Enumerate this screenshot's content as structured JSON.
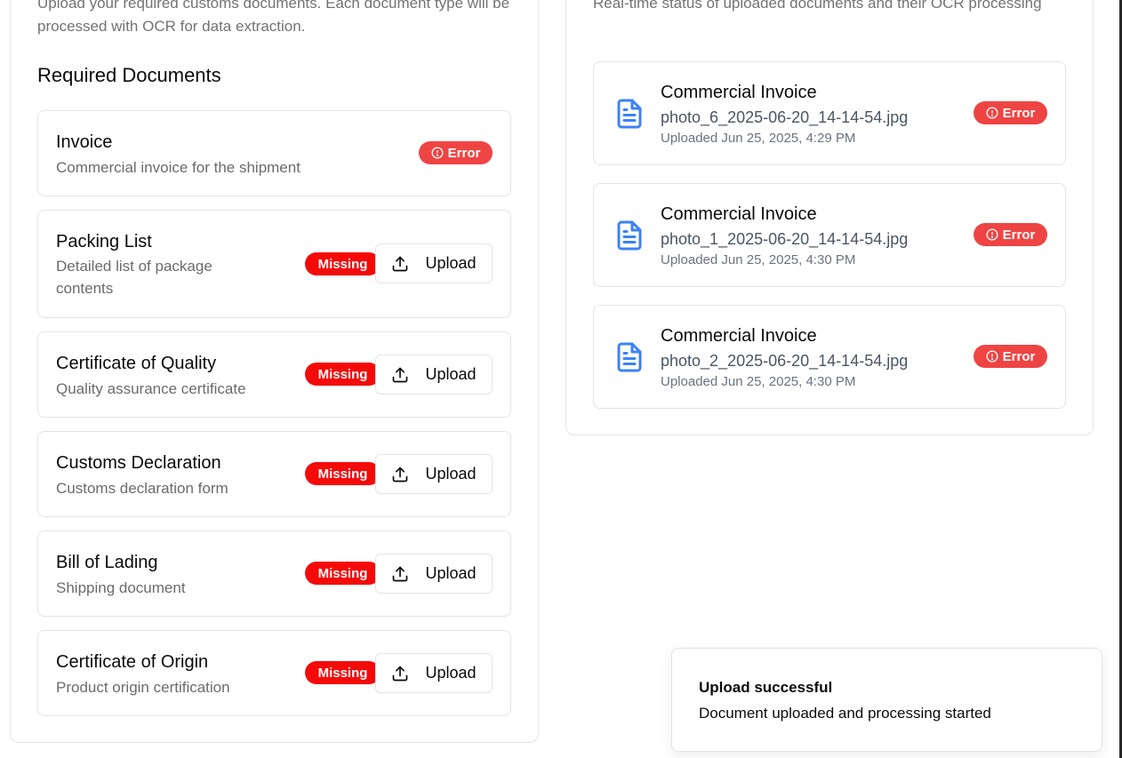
{
  "left_panel": {
    "description": "Upload your required customs documents. Each document type will be processed with OCR for data extraction.",
    "section_title": "Required Documents",
    "upload_label": "Upload",
    "documents": [
      {
        "title": "Invoice",
        "subtitle": "Commercial invoice for the shipment",
        "status": "Error"
      },
      {
        "title": "Packing List",
        "subtitle": "Detailed list of package contents",
        "status": "Missing"
      },
      {
        "title": "Certificate of Quality",
        "subtitle": "Quality assurance certificate",
        "status": "Missing"
      },
      {
        "title": "Customs Declaration",
        "subtitle": "Customs declaration form",
        "status": "Missing"
      },
      {
        "title": "Bill of Lading",
        "subtitle": "Shipping document",
        "status": "Missing"
      },
      {
        "title": "Certificate of Origin",
        "subtitle": "Product origin certification",
        "status": "Missing"
      }
    ]
  },
  "right_panel": {
    "description": "Real-time status of uploaded documents and their OCR processing",
    "files": [
      {
        "title": "Commercial Invoice",
        "filename": "photo_6_2025-06-20_14-14-54.jpg",
        "uploaded": "Uploaded Jun 25, 2025, 4:29 PM",
        "status": "Error"
      },
      {
        "title": "Commercial Invoice",
        "filename": "photo_1_2025-06-20_14-14-54.jpg",
        "uploaded": "Uploaded Jun 25, 2025, 4:30 PM",
        "status": "Error"
      },
      {
        "title": "Commercial Invoice",
        "filename": "photo_2_2025-06-20_14-14-54.jpg",
        "uploaded": "Uploaded Jun 25, 2025, 4:30 PM",
        "status": "Error"
      }
    ]
  },
  "toast": {
    "title": "Upload successful",
    "description": "Document uploaded and processing started"
  },
  "colors": {
    "error": "#ef4444",
    "missing": "#f50a0a",
    "file_icon": "#3b82f6",
    "border": "#e4e4e7"
  },
  "icons": {
    "error_badge": "alert-circle-icon",
    "upload": "upload-icon",
    "file": "file-text-icon"
  }
}
